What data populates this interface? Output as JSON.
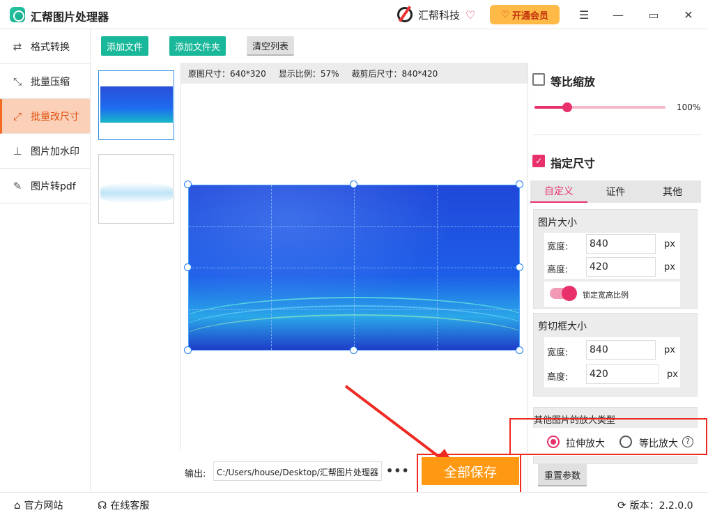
{
  "app": {
    "title": "汇帮图片处理器",
    "brand": "汇帮科技",
    "vip_label": "开通会员"
  },
  "sidebar": {
    "items": [
      {
        "label": "格式转换",
        "icon": "format-convert-icon"
      },
      {
        "label": "批量压缩",
        "icon": "compress-icon"
      },
      {
        "label": "批量改尺寸",
        "icon": "resize-icon",
        "active": true
      },
      {
        "label": "图片加水印",
        "icon": "watermark-icon"
      },
      {
        "label": "图片转pdf",
        "icon": "pdf-icon"
      }
    ]
  },
  "toolbar": {
    "add_file": "添加文件",
    "add_folder": "添加文件夹",
    "clear_list": "清空列表"
  },
  "preview": {
    "original_size": "原图尺寸：640*320",
    "display_ratio": "显示比例：57%",
    "cropped_size": "裁剪后尺寸：840*420"
  },
  "output": {
    "label": "输出:",
    "path": "C:/Users/house/Desktop/汇帮图片处理器",
    "more": "•••",
    "save_all": "全部保存"
  },
  "right": {
    "proportional_scale": {
      "label": "等比缩放",
      "checked": false,
      "percent": "100%",
      "value": 0.25
    },
    "specify_size": {
      "label": "指定尺寸",
      "checked": true
    },
    "tabs": [
      "自定义",
      "证件",
      "其他"
    ],
    "image_size": {
      "title": "图片大小",
      "width_label": "宽度:",
      "width": "840",
      "height_label": "高度:",
      "height": "420",
      "unit": "px",
      "lock_label": "锁定宽高比例"
    },
    "crop_size": {
      "title": "剪切框大小",
      "width_label": "宽度:",
      "width": "840",
      "height_label": "高度:",
      "height": "420",
      "unit": "px"
    },
    "enlarge": {
      "title": "其他图片的放大类型",
      "option1": "拉伸放大",
      "option2": "等比放大",
      "help": "?"
    },
    "reset": "重置参数"
  },
  "status": {
    "website": "官方网站",
    "support": "在线客服",
    "version": "版本：2.2.0.0"
  },
  "colors": {
    "accent": "#e8316a",
    "green": "#19b89a",
    "orange": "#ff9913",
    "highlight": "#ee2a22"
  }
}
